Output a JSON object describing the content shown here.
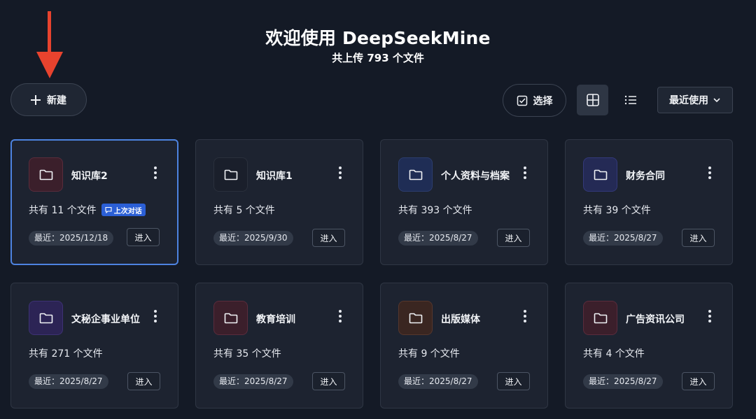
{
  "header": {
    "title": "欢迎使用 DeepSeekMine",
    "subtitle": "共上传 793 个文件"
  },
  "toolbar": {
    "new_label": "新建",
    "select_label": "选择",
    "sort_label": "最近使用",
    "active_view": "grid"
  },
  "colors": {
    "background": "#141a26",
    "card": "#1d2330",
    "active_border": "#4d83e0",
    "badge": "#2b5fd6",
    "arrow": "#e8432e"
  },
  "cards": [
    {
      "name": "知识库2",
      "count": "共有 11 个文件",
      "badge": "上次对话",
      "date": "最近：2025/12/18",
      "enter": "进入",
      "icon_bg": "#3b1f2b",
      "icon_border": "#5a2c3c",
      "active": true
    },
    {
      "name": "知识库1",
      "count": "共有 5 个文件",
      "date": "最近：2025/9/30",
      "enter": "进入",
      "icon_bg": "#1a1f2b",
      "icon_border": "#2a303c"
    },
    {
      "name": "个人资料与档案",
      "count": "共有 393 个文件",
      "date": "最近：2025/8/27",
      "enter": "进入",
      "icon_bg": "#1f2d55",
      "icon_border": "#2c3d6e"
    },
    {
      "name": "财务合同",
      "count": "共有 39 个文件",
      "date": "最近：2025/8/27",
      "enter": "进入",
      "icon_bg": "#242a55",
      "icon_border": "#33397a"
    },
    {
      "name": "文秘企事业单位",
      "count": "共有 271 个文件",
      "date": "最近：2025/8/27",
      "enter": "进入",
      "icon_bg": "#2c2455",
      "icon_border": "#3d3274"
    },
    {
      "name": "教育培训",
      "count": "共有 35 个文件",
      "date": "最近：2025/8/27",
      "enter": "进入",
      "icon_bg": "#3b1f2b",
      "icon_border": "#5a2c3c"
    },
    {
      "name": "出版媒体",
      "count": "共有 9 个文件",
      "date": "最近：2025/8/27",
      "enter": "进入",
      "icon_bg": "#3a2621",
      "icon_border": "#56372c"
    },
    {
      "name": "广告资讯公司",
      "count": "共有 4 个文件",
      "date": "最近：2025/8/27",
      "enter": "进入",
      "icon_bg": "#3b1f2b",
      "icon_border": "#5a2c3c"
    }
  ]
}
